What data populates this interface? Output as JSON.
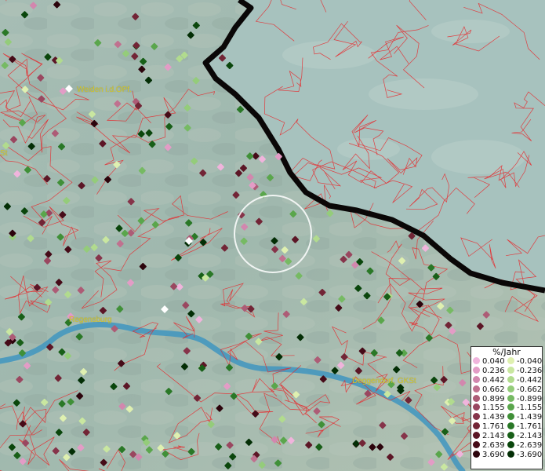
{
  "map": {
    "cities": [
      {
        "id": "weiden",
        "label": "Weiden i.d.OPf."
      },
      {
        "id": "regensburg",
        "label": "Regensburg"
      },
      {
        "id": "deggendorf",
        "label": "Deggendorf, GKSt"
      },
      {
        "id": "edge",
        "label": "St"
      }
    ]
  },
  "legend": {
    "title": "%/Jahr",
    "rows": [
      {
        "pos": "0.040",
        "neg": "-0.040",
        "pos_color": "#f0b4dc",
        "neg_color": "#dff0b0"
      },
      {
        "pos": "0.236",
        "neg": "-0.236",
        "pos_color": "#e39cc6",
        "neg_color": "#c9e7a0"
      },
      {
        "pos": "0.442",
        "neg": "-0.442",
        "pos_color": "#d287ae",
        "neg_color": "#b1db8e"
      },
      {
        "pos": "0.662",
        "neg": "-0.662",
        "pos_color": "#c0718f",
        "neg_color": "#94cc7a"
      },
      {
        "pos": "0.899",
        "neg": "-0.899",
        "pos_color": "#ad5c76",
        "neg_color": "#76ba63"
      },
      {
        "pos": "1.155",
        "neg": "-1.155",
        "pos_color": "#9a4760",
        "neg_color": "#5aa64c"
      },
      {
        "pos": "1.439",
        "neg": "-1.439",
        "pos_color": "#86344a",
        "neg_color": "#409038"
      },
      {
        "pos": "1.761",
        "neg": "-1.761",
        "pos_color": "#722536",
        "neg_color": "#2a7827"
      },
      {
        "pos": "2.143",
        "neg": "-2.143",
        "pos_color": "#5c1626",
        "neg_color": "#185f18"
      },
      {
        "pos": "2.639",
        "neg": "-2.639",
        "pos_color": "#460b18",
        "neg_color": "#0a460c"
      },
      {
        "pos": "3.690",
        "neg": "-3.690",
        "pos_color": "#2c040c",
        "neg_color": "#032e05"
      }
    ]
  },
  "colors": {
    "boundary": "#e8262a",
    "border": "#0a0707",
    "river": "#3f95bf",
    "selection_circle": "#ffffff"
  }
}
